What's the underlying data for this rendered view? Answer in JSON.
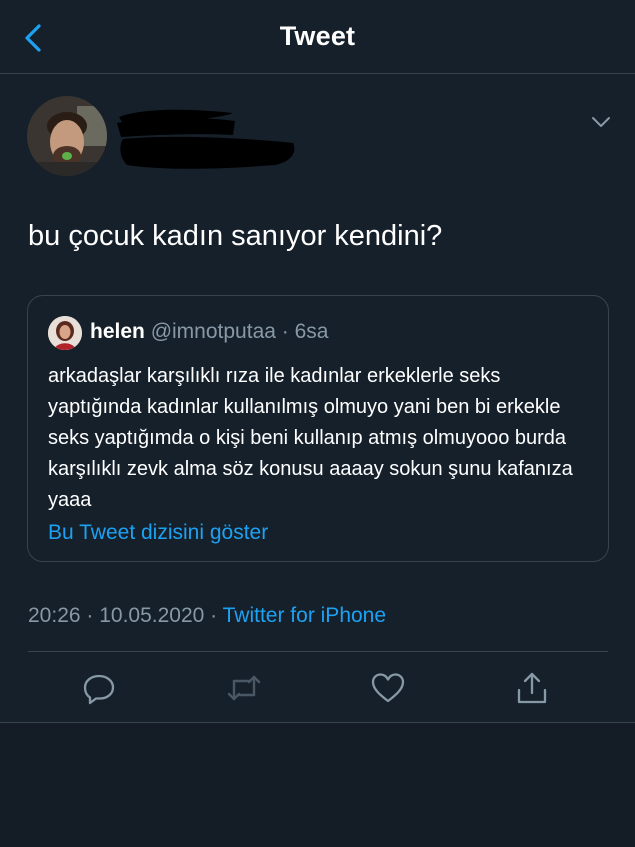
{
  "header": {
    "title": "Tweet",
    "back_icon": "chevron-left-icon"
  },
  "tweet": {
    "author_avatar": "avatar",
    "author_name_redacted": true,
    "more_icon": "chevron-down-icon",
    "text": "bu çocuk kadın sanıyor kendini?",
    "timestamp": "20:26 · 10.05.2020",
    "separator": " · ",
    "source": "Twitter for iPhone"
  },
  "quoted_tweet": {
    "name": "helen",
    "handle": "@imnotputaa",
    "time": "· 6sa",
    "text": "arkadaşlar karşılıklı rıza ile kadınlar erkeklerle seks yaptığında kadınlar kullanılmış olmuyo yani ben bi erkekle seks yaptığımda o kişi beni kullanıp atmış olmuyooo burda karşılıklı zevk alma söz konusu aaaay sokun şunu kafanıza yaaa",
    "show_thread": "Bu Tweet dizisini göster"
  },
  "actions": {
    "reply_icon": "reply-icon",
    "retweet_icon": "retweet-icon",
    "like_icon": "heart-icon",
    "share_icon": "share-icon"
  },
  "colors": {
    "background": "#15202b",
    "accent": "#1da1f2",
    "muted": "#8899a6",
    "border": "#38444d"
  }
}
